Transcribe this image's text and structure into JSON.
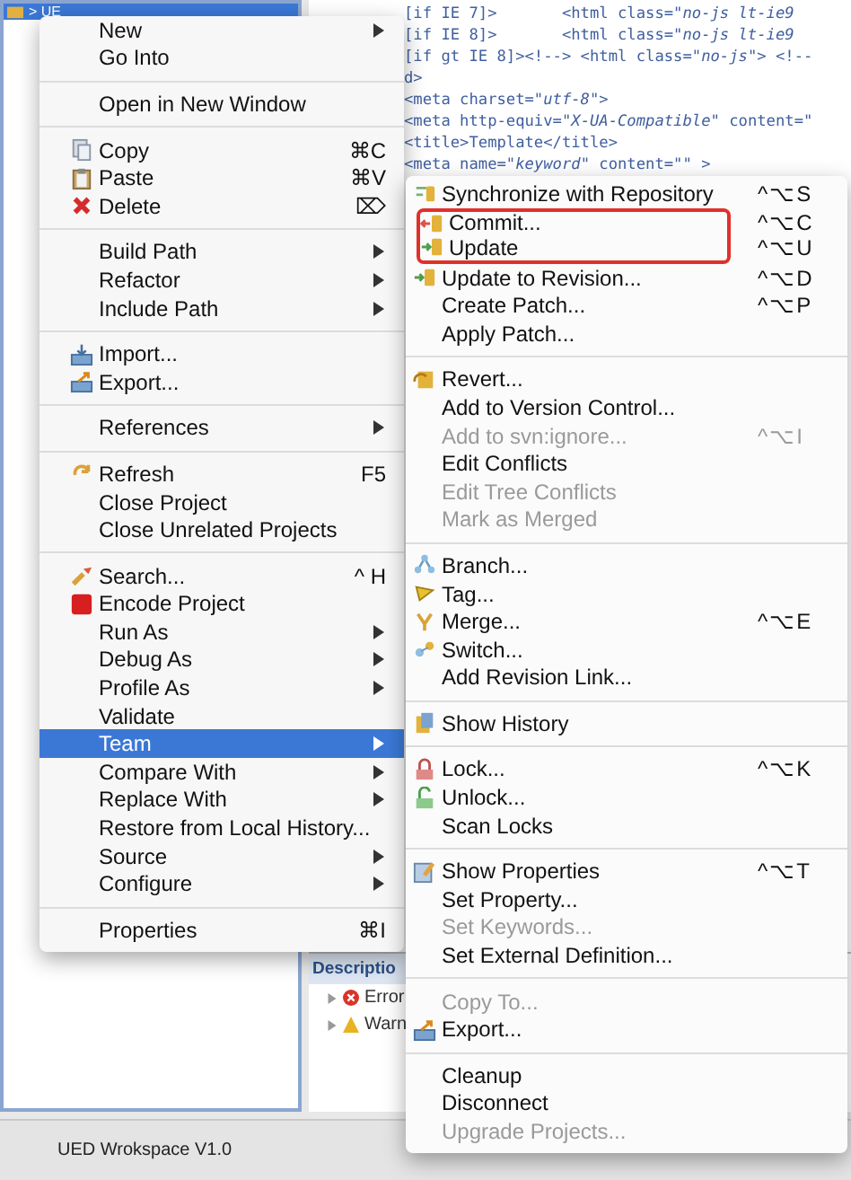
{
  "explorer": {
    "selected_row": {
      "text": "> UE",
      "selected": true
    }
  },
  "editor": {
    "lines": [
      "[if IE 7]>       <html class=\"*no-js lt-ie9*",
      "[if IE 8]>       <html class=\"*no-js lt-ie9*",
      "[if gt IE 8]><!--> <html class=\"*no-js*\"> <!--",
      "d>",
      "<meta charset=\"*utf-8*\">",
      "<meta http-equiv=\"*X-UA-Compatible*\" content=\"",
      "<title>Template</title>",
      "<meta name=\"*keyword*\" content=\"\" >"
    ]
  },
  "problems": {
    "header": "Descriptio",
    "rows": [
      {
        "label": "Error",
        "kind": "error"
      },
      {
        "label": "Warn",
        "kind": "warning"
      }
    ]
  },
  "status_bar": {
    "text": "UED Wrokspace V1.0"
  },
  "context_menu": {
    "sections": [
      [
        {
          "label": "New",
          "submenu": true,
          "selected": false
        },
        {
          "label": "Go Into",
          "selected": false
        }
      ],
      [
        {
          "label": "Open in New Window",
          "selected": false
        }
      ],
      [
        {
          "label": "Copy",
          "kind": "copy",
          "shortcut": "⌘C",
          "selected": false
        },
        {
          "label": "Paste",
          "kind": "paste",
          "shortcut": "⌘V",
          "selected": false
        },
        {
          "label": "Delete",
          "kind": "delete",
          "shortcut": "⌦",
          "selected": false
        }
      ],
      [
        {
          "label": "Build Path",
          "submenu": true,
          "selected": false
        },
        {
          "label": "Refactor",
          "submenu": true,
          "selected": false
        },
        {
          "label": "Include Path",
          "submenu": true,
          "selected": false
        }
      ],
      [
        {
          "label": "Import...",
          "kind": "import",
          "selected": false
        },
        {
          "label": "Export...",
          "kind": "export",
          "selected": false
        }
      ],
      [
        {
          "label": "References",
          "submenu": true,
          "selected": false
        }
      ],
      [
        {
          "label": "Refresh",
          "kind": "refresh",
          "shortcut": "F5",
          "selected": false
        },
        {
          "label": "Close Project",
          "selected": false
        },
        {
          "label": "Close Unrelated Projects",
          "selected": false
        }
      ],
      [
        {
          "label": "Search...",
          "kind": "search",
          "shortcut": "^ H",
          "selected": false
        },
        {
          "label": "Encode Project",
          "kind": "encode",
          "selected": false
        },
        {
          "label": "Run As",
          "submenu": true,
          "selected": false
        },
        {
          "label": "Debug As",
          "submenu": true,
          "selected": false
        },
        {
          "label": "Profile As",
          "submenu": true,
          "selected": false
        },
        {
          "label": "Validate",
          "selected": false
        },
        {
          "label": "Team",
          "submenu": true,
          "selected": true
        },
        {
          "label": "Compare With",
          "submenu": true,
          "selected": false
        },
        {
          "label": "Replace With",
          "submenu": true,
          "selected": false
        },
        {
          "label": "Restore from Local History...",
          "selected": false
        },
        {
          "label": "Source",
          "submenu": true,
          "selected": false
        },
        {
          "label": "Configure",
          "submenu": true,
          "selected": false
        }
      ],
      [
        {
          "label": "Properties",
          "shortcut": "⌘I",
          "selected": false
        }
      ]
    ]
  },
  "team_submenu": {
    "sections": [
      [
        {
          "label": "Synchronize with Repository",
          "kind": "sync",
          "shortcut": "^⌥S",
          "disabled": false,
          "highlighted": false
        },
        {
          "label": "Commit...",
          "kind": "commit",
          "shortcut": "^⌥C",
          "disabled": false,
          "highlighted": true
        },
        {
          "label": "Update",
          "kind": "update",
          "shortcut": "^⌥U",
          "disabled": false,
          "highlighted": true
        },
        {
          "label": "Update to Revision...",
          "kind": "update",
          "shortcut": "^⌥D",
          "disabled": false,
          "highlighted": false
        },
        {
          "label": "Create Patch...",
          "shortcut": "^⌥P",
          "disabled": false,
          "highlighted": false
        },
        {
          "label": "Apply Patch...",
          "disabled": false,
          "highlighted": false
        }
      ],
      [
        {
          "label": "Revert...",
          "kind": "revert",
          "disabled": false,
          "highlighted": false
        },
        {
          "label": "Add to Version Control...",
          "disabled": false,
          "highlighted": false
        },
        {
          "label": "Add to svn:ignore...",
          "shortcut": "^⌥I",
          "disabled": true,
          "highlighted": false
        },
        {
          "label": "Edit Conflicts",
          "disabled": false,
          "highlighted": false
        },
        {
          "label": "Edit Tree Conflicts",
          "disabled": true,
          "highlighted": false
        },
        {
          "label": "Mark as Merged",
          "disabled": true,
          "highlighted": false
        }
      ],
      [
        {
          "label": "Branch...",
          "kind": "branch",
          "disabled": false,
          "highlighted": false
        },
        {
          "label": "Tag...",
          "kind": "tag",
          "disabled": false,
          "highlighted": false
        },
        {
          "label": "Merge...",
          "kind": "merge",
          "shortcut": "^⌥E",
          "disabled": false,
          "highlighted": false
        },
        {
          "label": "Switch...",
          "kind": "switch",
          "disabled": false,
          "highlighted": false
        },
        {
          "label": "Add Revision Link...",
          "disabled": false,
          "highlighted": false
        }
      ],
      [
        {
          "label": "Show History",
          "kind": "history",
          "disabled": false,
          "highlighted": false
        }
      ],
      [
        {
          "label": "Lock...",
          "kind": "lock",
          "shortcut": "^⌥K",
          "disabled": false,
          "highlighted": false
        },
        {
          "label": "Unlock...",
          "kind": "unlock",
          "disabled": false,
          "highlighted": false
        },
        {
          "label": "Scan Locks",
          "disabled": false,
          "highlighted": false
        }
      ],
      [
        {
          "label": "Show Properties",
          "kind": "properties",
          "shortcut": "^⌥T",
          "disabled": false,
          "highlighted": false
        },
        {
          "label": "Set Property...",
          "disabled": false,
          "highlighted": false
        },
        {
          "label": "Set Keywords...",
          "disabled": true,
          "highlighted": false
        },
        {
          "label": "Set External Definition...",
          "disabled": false,
          "highlighted": false
        }
      ],
      [
        {
          "label": "Copy To...",
          "disabled": true,
          "highlighted": false
        },
        {
          "label": "Export...",
          "kind": "export",
          "disabled": false,
          "highlighted": false
        }
      ],
      [
        {
          "label": "Cleanup",
          "disabled": false,
          "highlighted": false
        },
        {
          "label": "Disconnect",
          "disabled": false,
          "highlighted": false
        },
        {
          "label": "Upgrade Projects...",
          "disabled": true,
          "highlighted": false
        }
      ]
    ]
  }
}
